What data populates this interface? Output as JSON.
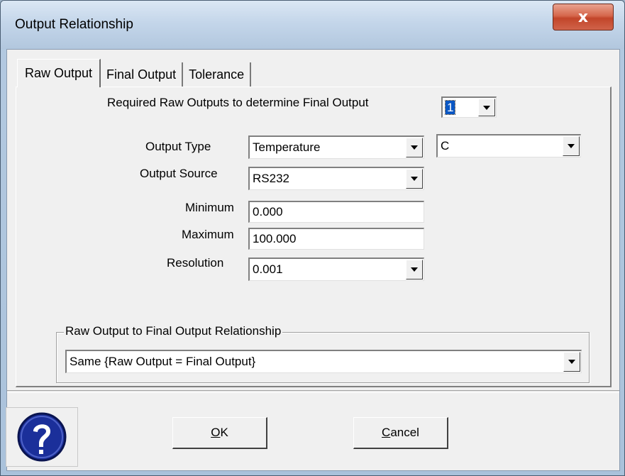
{
  "window": {
    "title": "Output Relationship",
    "close_glyph": "x"
  },
  "tabs": [
    {
      "label": "Raw Output",
      "active": true
    },
    {
      "label": "Final Output",
      "active": false
    },
    {
      "label": "Tolerance",
      "active": false
    }
  ],
  "raw_output": {
    "required_label": "Required Raw Outputs to determine Final Output",
    "required_value": "1",
    "output_type_label": "Output Type",
    "output_type_value": "Temperature",
    "unit_value": "C",
    "output_source_label": "Output Source",
    "output_source_value": "RS232",
    "minimum_label": "Minimum",
    "minimum_value": "0.000",
    "maximum_label": "Maximum",
    "maximum_value": "100.000",
    "resolution_label": "Resolution",
    "resolution_value": "0.001"
  },
  "relationship": {
    "group_label": "Raw Output to Final Output Relationship",
    "value": "Same {Raw Output = Final Output}"
  },
  "buttons": {
    "ok_mnemonic": "O",
    "ok_rest": "K",
    "cancel_mnemonic": "C",
    "cancel_rest": "ancel"
  },
  "icons": {
    "help": "help-question-icon",
    "dropdown": "dropdown-arrow-icon",
    "close": "close-icon"
  },
  "colors": {
    "help_blue": "#1b2f9a",
    "close_red": "#c2452a",
    "selection": "#0a57c4"
  }
}
